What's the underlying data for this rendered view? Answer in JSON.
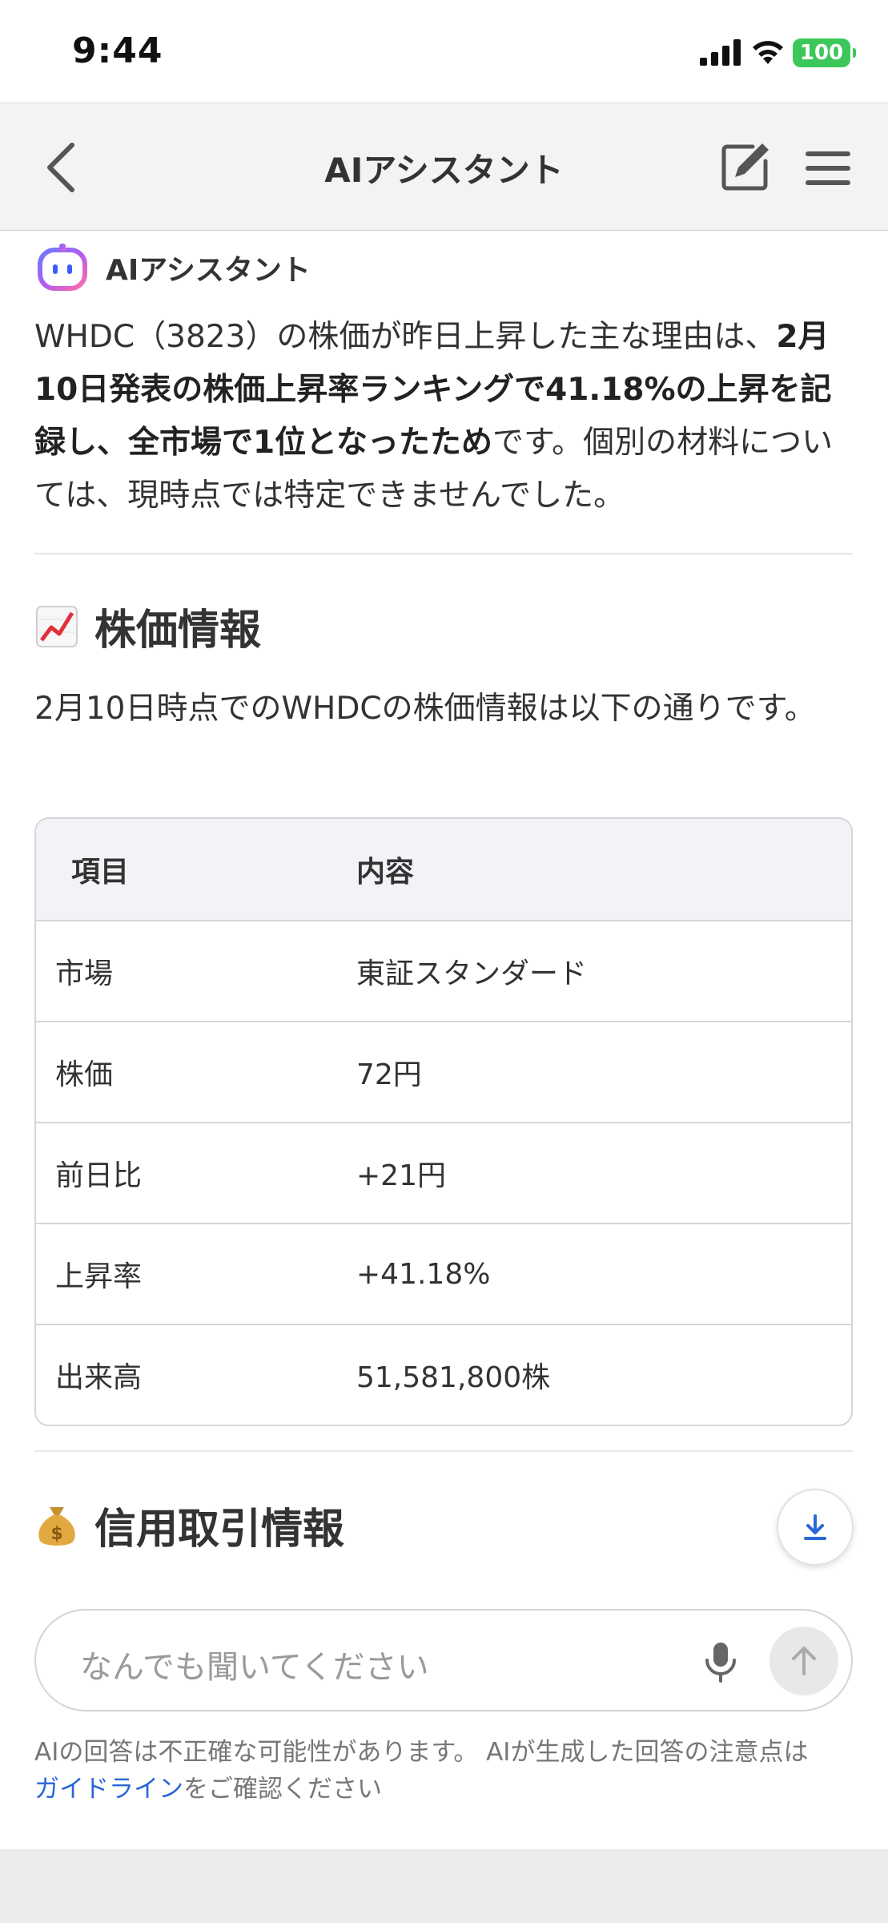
{
  "status_bar": {
    "time": "9:44",
    "battery": "100",
    "battery_color": "#3cc75a"
  },
  "nav": {
    "title": "AIアシスタント",
    "back_icon": "chevron-left-icon",
    "edit_icon": "edit-icon",
    "menu_icon": "hamburger-menu-icon"
  },
  "assistant": {
    "name": "AIアシスタント",
    "avatar_icon": "bot-icon"
  },
  "answer": {
    "part1": "WHDC（3823）の株価が昨日上昇した主な理由は、",
    "bold": "2月10日発表の株価上昇率ランキングで41.18%の上昇を記録し、全市場で1位となったため",
    "part2": "です。個別の材料については、現時点では特定できませんでした。"
  },
  "stock_section": {
    "emoji_icon": "chart-increasing-icon",
    "title": "株価情報",
    "lead": "2月10日時点でのWHDCの株価情報は以下の通りです。",
    "table": {
      "headers": [
        "項目",
        "内容"
      ],
      "rows": [
        [
          "市場",
          "東証スタンダード"
        ],
        [
          "株価",
          "72円"
        ],
        [
          "前日比",
          "+21円"
        ],
        [
          "上昇率",
          "+41.18%"
        ],
        [
          "出来高",
          "51,581,800株"
        ]
      ]
    }
  },
  "credit_section": {
    "emoji_icon": "money-bag-icon",
    "title": "信用取引情報"
  },
  "input": {
    "placeholder": "なんでも聞いてください",
    "mic_icon": "microphone-icon",
    "send_icon": "arrow-up-icon"
  },
  "download_icon": "download-icon",
  "disclaimer": {
    "text": "AIの回答は不正確な可能性があります。 AIが生成した回答の注意点は",
    "link": "ガイドライン",
    "suffix": "をご確認ください"
  },
  "colors": {
    "accent": "#2a67d6",
    "nav_bg": "#f3f3f3",
    "table_header_bg": "#f2f3f7"
  }
}
